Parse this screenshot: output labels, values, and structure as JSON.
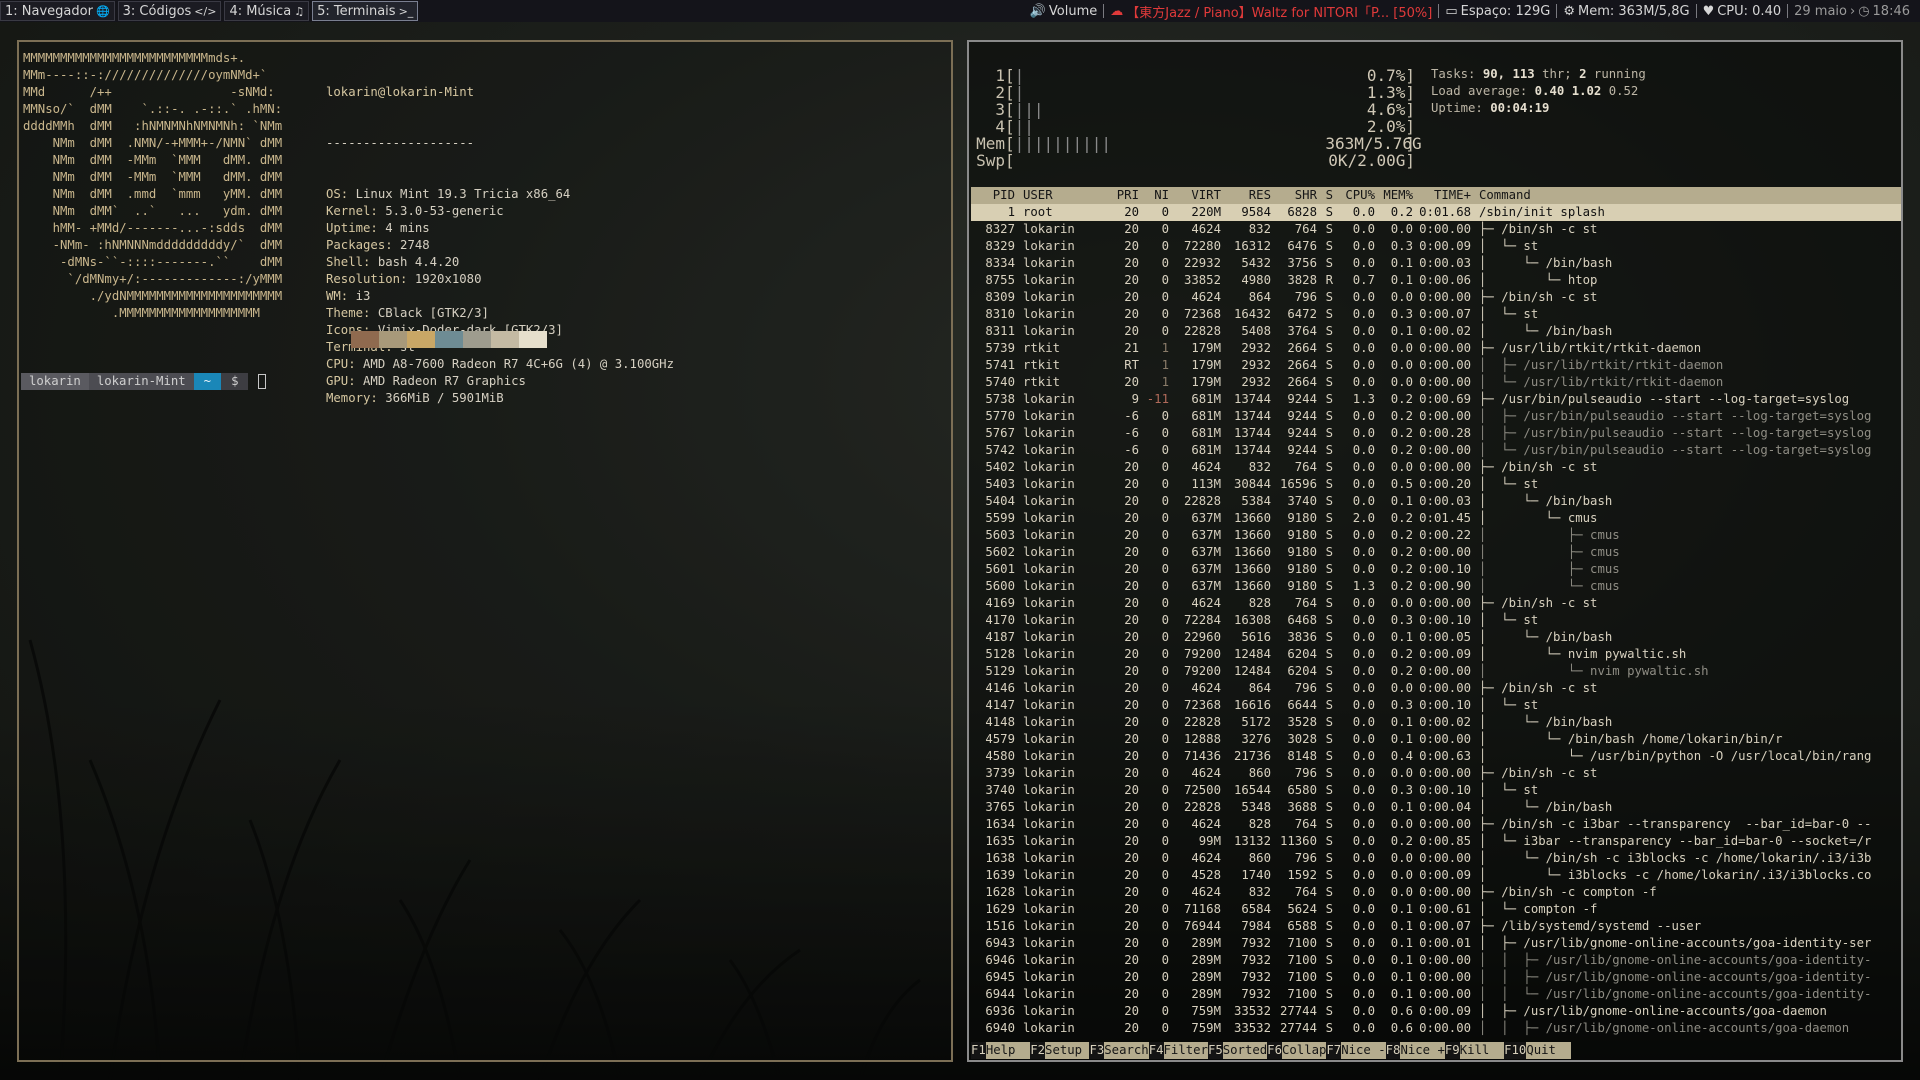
{
  "workspaces": [
    {
      "label": "1: Navegador",
      "icon": "globe-icon",
      "glyph": "🌐",
      "focused": false
    },
    {
      "label": "3: Códigos",
      "icon": "code-icon",
      "glyph": "</>",
      "focused": false
    },
    {
      "label": "4: Música",
      "icon": "music-icon",
      "glyph": "♫",
      "focused": false
    },
    {
      "label": "5: Terminais",
      "icon": "terminal-icon",
      "glyph": ">_",
      "focused": true
    }
  ],
  "statusbar": {
    "volume": "Volume",
    "music": "【東方Jazz / Piano】Waltz for NITORI「P... [50%]",
    "disk": "Espaço: 129G",
    "mem": "Mem: 363M/5,8G",
    "cpu": "CPU: 0.40",
    "date": "29 maio",
    "time": "18:46",
    "music_color": "#e03a3a"
  },
  "neofetch": {
    "ascii": [
      "MMMMMMMMMMMMMMMMMMMMMMMMMmds+.",
      "MMm----::-://////////////oymNMd+`",
      "MMd      /++                -sNMd:",
      "MMNso/`  dMM    `.::-. .-::.` .hMN:",
      "ddddMMh  dMM   :hNMNMNhNMNMNh: `NMm",
      "    NMm  dMM  .NMN/-+MMM+-/NMN` dMM",
      "    NMm  dMM  -MMm  `MMM   dMM. dMM",
      "    NMm  dMM  -MMm  `MMM   dMM. dMM",
      "    NMm  dMM  .mmd  `mmm   yMM. dMM",
      "    NMm  dMM`  ..`   ...   ydm. dMM",
      "    hMM- +MMd/-------...-:sdds  dMM",
      "    -NMm- :hNMNNNmdddddddddy/`  dMM",
      "     -dMNs-``-::::-------.``    dMM",
      "      `/dMNmy+/:-------------:/yMMM",
      "         ./ydNMMMMMMMMMMMMMMMMMMMMM",
      "            .MMMMMMMMMMMMMMMMMMM"
    ],
    "user_host": "lokarin@lokarin-Mint",
    "underline": "--------------------",
    "info": [
      {
        "key": "OS",
        "value": "Linux Mint 19.3 Tricia x86_64"
      },
      {
        "key": "Kernel",
        "value": "5.3.0-53-generic"
      },
      {
        "key": "Uptime",
        "value": "4 mins"
      },
      {
        "key": "Packages",
        "value": "2748"
      },
      {
        "key": "Shell",
        "value": "bash 4.4.20"
      },
      {
        "key": "Resolution",
        "value": "1920x1080"
      },
      {
        "key": "WM",
        "value": "i3"
      },
      {
        "key": "Theme",
        "value": "CBlack [GTK2/3]"
      },
      {
        "key": "Icons",
        "value": "Vimix-Doder-dark [GTK2/3]"
      },
      {
        "key": "Terminal",
        "value": "st"
      },
      {
        "key": "CPU",
        "value": "AMD A8-7600 Radeon R7 4C+6G (4) @ 3.100GHz"
      },
      {
        "key": "GPU",
        "value": "AMD Radeon R7 Graphics"
      },
      {
        "key": "Memory",
        "value": "366MiB / 5901MiB"
      }
    ],
    "palette": [
      "#8f6a4f",
      "#a8997a",
      "#c9a766",
      "#6e8c94",
      "#9e9c8e",
      "#c4baa3",
      "#e6dfcc"
    ]
  },
  "prompt": {
    "user": "lokarin",
    "host": "lokarin-Mint",
    "dir": "~",
    "symbol": "$"
  },
  "htop": {
    "cpus": [
      {
        "n": "1",
        "bars": "|",
        "val": "0.7%"
      },
      {
        "n": "2",
        "bars": "|",
        "val": "1.3%"
      },
      {
        "n": "3",
        "bars": "|||",
        "val": "4.6%"
      },
      {
        "n": "4",
        "bars": "||",
        "val": "2.0%"
      }
    ],
    "mem": {
      "label": "Mem",
      "bars": "||||||||||",
      "val": "363M/5.76G"
    },
    "swp": {
      "label": "Swp",
      "bars": "",
      "val": "0K/2.00G"
    },
    "tasks_label": "Tasks:",
    "tasks": "90,",
    "threads": "113",
    "thr_label": "thr;",
    "running": "2",
    "running_label": "running",
    "load_label": "Load average:",
    "load1": "0.40",
    "load5": "1.02",
    "load15": "0.52",
    "uptime_label": "Uptime:",
    "uptime": "00:04:19",
    "headers": [
      "PID",
      "USER",
      "PRI",
      "NI",
      "VIRT",
      "RES",
      "SHR",
      "S",
      "CPU%",
      "MEM%",
      "TIME+",
      "Command"
    ],
    "rows": [
      [
        "1",
        "root",
        "20",
        "0",
        "220M",
        "9584",
        "6828",
        "S",
        "0.0",
        "0.2",
        "0:01.68",
        "/sbin/init splash",
        0
      ],
      [
        "8327",
        "lokarin",
        "20",
        "0",
        "4624",
        "832",
        "764",
        "S",
        "0.0",
        "0.0",
        "0:00.00",
        "├─ /bin/sh -c st",
        0
      ],
      [
        "8329",
        "lokarin",
        "20",
        "0",
        "72280",
        "16312",
        "6476",
        "S",
        "0.0",
        "0.3",
        "0:00.09",
        "│  └─ st",
        0
      ],
      [
        "8334",
        "lokarin",
        "20",
        "0",
        "22932",
        "5432",
        "3756",
        "S",
        "0.0",
        "0.1",
        "0:00.03",
        "│     └─ /bin/bash",
        0
      ],
      [
        "8755",
        "lokarin",
        "20",
        "0",
        "33852",
        "4980",
        "3828",
        "R",
        "0.7",
        "0.1",
        "0:00.06",
        "│        └─ htop",
        0
      ],
      [
        "8309",
        "lokarin",
        "20",
        "0",
        "4624",
        "864",
        "796",
        "S",
        "0.0",
        "0.0",
        "0:00.00",
        "├─ /bin/sh -c st",
        0
      ],
      [
        "8310",
        "lokarin",
        "20",
        "0",
        "72368",
        "16432",
        "6472",
        "S",
        "0.0",
        "0.3",
        "0:00.07",
        "│  └─ st",
        0
      ],
      [
        "8311",
        "lokarin",
        "20",
        "0",
        "22828",
        "5408",
        "3764",
        "S",
        "0.0",
        "0.1",
        "0:00.02",
        "│     └─ /bin/bash",
        0
      ],
      [
        "5739",
        "rtkit",
        "21",
        "1",
        "179M",
        "2932",
        "2664",
        "S",
        "0.0",
        "0.0",
        "0:00.00",
        "├─ /usr/lib/rtkit/rtkit-daemon",
        0
      ],
      [
        "5741",
        "rtkit",
        "RT",
        "1",
        "179M",
        "2932",
        "2664",
        "S",
        "0.0",
        "0.0",
        "0:00.00",
        "│  ├─ /usr/lib/rtkit/rtkit-daemon",
        1
      ],
      [
        "5740",
        "rtkit",
        "20",
        "1",
        "179M",
        "2932",
        "2664",
        "S",
        "0.0",
        "0.0",
        "0:00.00",
        "│  └─ /usr/lib/rtkit/rtkit-daemon",
        1
      ],
      [
        "5738",
        "lokarin",
        "9",
        "-11",
        "681M",
        "13744",
        "9244",
        "S",
        "1.3",
        "0.2",
        "0:00.69",
        "├─ /usr/bin/pulseaudio --start --log-target=syslog",
        0
      ],
      [
        "5770",
        "lokarin",
        "-6",
        "0",
        "681M",
        "13744",
        "9244",
        "S",
        "0.0",
        "0.2",
        "0:00.00",
        "│  ├─ /usr/bin/pulseaudio --start --log-target=syslog",
        1
      ],
      [
        "5767",
        "lokarin",
        "-6",
        "0",
        "681M",
        "13744",
        "9244",
        "S",
        "0.0",
        "0.2",
        "0:00.28",
        "│  ├─ /usr/bin/pulseaudio --start --log-target=syslog",
        1
      ],
      [
        "5742",
        "lokarin",
        "-6",
        "0",
        "681M",
        "13744",
        "9244",
        "S",
        "0.0",
        "0.2",
        "0:00.00",
        "│  └─ /usr/bin/pulseaudio --start --log-target=syslog",
        1
      ],
      [
        "5402",
        "lokarin",
        "20",
        "0",
        "4624",
        "832",
        "764",
        "S",
        "0.0",
        "0.0",
        "0:00.00",
        "├─ /bin/sh -c st",
        0
      ],
      [
        "5403",
        "lokarin",
        "20",
        "0",
        "113M",
        "30844",
        "16596",
        "S",
        "0.0",
        "0.5",
        "0:00.20",
        "│  └─ st",
        0
      ],
      [
        "5404",
        "lokarin",
        "20",
        "0",
        "22828",
        "5384",
        "3740",
        "S",
        "0.0",
        "0.1",
        "0:00.03",
        "│     └─ /bin/bash",
        0
      ],
      [
        "5599",
        "lokarin",
        "20",
        "0",
        "637M",
        "13660",
        "9180",
        "S",
        "2.0",
        "0.2",
        "0:01.45",
        "│        └─ cmus",
        0
      ],
      [
        "5603",
        "lokarin",
        "20",
        "0",
        "637M",
        "13660",
        "9180",
        "S",
        "0.0",
        "0.2",
        "0:00.22",
        "│           ├─ cmus",
        1
      ],
      [
        "5602",
        "lokarin",
        "20",
        "0",
        "637M",
        "13660",
        "9180",
        "S",
        "0.0",
        "0.2",
        "0:00.00",
        "│           ├─ cmus",
        1
      ],
      [
        "5601",
        "lokarin",
        "20",
        "0",
        "637M",
        "13660",
        "9180",
        "S",
        "0.0",
        "0.2",
        "0:00.10",
        "│           ├─ cmus",
        1
      ],
      [
        "5600",
        "lokarin",
        "20",
        "0",
        "637M",
        "13660",
        "9180",
        "S",
        "1.3",
        "0.2",
        "0:00.90",
        "│           └─ cmus",
        1
      ],
      [
        "4169",
        "lokarin",
        "20",
        "0",
        "4624",
        "828",
        "764",
        "S",
        "0.0",
        "0.0",
        "0:00.00",
        "├─ /bin/sh -c st",
        0
      ],
      [
        "4170",
        "lokarin",
        "20",
        "0",
        "72284",
        "16308",
        "6468",
        "S",
        "0.0",
        "0.3",
        "0:00.10",
        "│  └─ st",
        0
      ],
      [
        "4187",
        "lokarin",
        "20",
        "0",
        "22960",
        "5616",
        "3836",
        "S",
        "0.0",
        "0.1",
        "0:00.05",
        "│     └─ /bin/bash",
        0
      ],
      [
        "5128",
        "lokarin",
        "20",
        "0",
        "79200",
        "12484",
        "6204",
        "S",
        "0.0",
        "0.2",
        "0:00.09",
        "│        └─ nvim pywaltic.sh",
        0
      ],
      [
        "5129",
        "lokarin",
        "20",
        "0",
        "79200",
        "12484",
        "6204",
        "S",
        "0.0",
        "0.2",
        "0:00.00",
        "│           └─ nvim pywaltic.sh",
        1
      ],
      [
        "4146",
        "lokarin",
        "20",
        "0",
        "4624",
        "864",
        "796",
        "S",
        "0.0",
        "0.0",
        "0:00.00",
        "├─ /bin/sh -c st",
        0
      ],
      [
        "4147",
        "lokarin",
        "20",
        "0",
        "72368",
        "16616",
        "6644",
        "S",
        "0.0",
        "0.3",
        "0:00.10",
        "│  └─ st",
        0
      ],
      [
        "4148",
        "lokarin",
        "20",
        "0",
        "22828",
        "5172",
        "3528",
        "S",
        "0.0",
        "0.1",
        "0:00.02",
        "│     └─ /bin/bash",
        0
      ],
      [
        "4579",
        "lokarin",
        "20",
        "0",
        "12888",
        "3276",
        "3028",
        "S",
        "0.0",
        "0.1",
        "0:00.00",
        "│        └─ /bin/bash /home/lokarin/bin/r",
        0
      ],
      [
        "4580",
        "lokarin",
        "20",
        "0",
        "71436",
        "21736",
        "8148",
        "S",
        "0.0",
        "0.4",
        "0:00.63",
        "│           └─ /usr/bin/python -O /usr/local/bin/rang",
        0
      ],
      [
        "3739",
        "lokarin",
        "20",
        "0",
        "4624",
        "860",
        "796",
        "S",
        "0.0",
        "0.0",
        "0:00.00",
        "├─ /bin/sh -c st",
        0
      ],
      [
        "3740",
        "lokarin",
        "20",
        "0",
        "72500",
        "16544",
        "6580",
        "S",
        "0.0",
        "0.3",
        "0:00.10",
        "│  └─ st",
        0
      ],
      [
        "3765",
        "lokarin",
        "20",
        "0",
        "22828",
        "5348",
        "3688",
        "S",
        "0.0",
        "0.1",
        "0:00.04",
        "│     └─ /bin/bash",
        0
      ],
      [
        "1634",
        "lokarin",
        "20",
        "0",
        "4624",
        "828",
        "764",
        "S",
        "0.0",
        "0.0",
        "0:00.00",
        "├─ /bin/sh -c i3bar --transparency  --bar_id=bar-0 --",
        0
      ],
      [
        "1635",
        "lokarin",
        "20",
        "0",
        "99M",
        "13132",
        "11360",
        "S",
        "0.0",
        "0.2",
        "0:00.85",
        "│  └─ i3bar --transparency --bar_id=bar-0 --socket=/r",
        0
      ],
      [
        "1638",
        "lokarin",
        "20",
        "0",
        "4624",
        "860",
        "796",
        "S",
        "0.0",
        "0.0",
        "0:00.00",
        "│     └─ /bin/sh -c i3blocks -c /home/lokarin/.i3/i3b",
        0
      ],
      [
        "1639",
        "lokarin",
        "20",
        "0",
        "4528",
        "1740",
        "1592",
        "S",
        "0.0",
        "0.0",
        "0:00.09",
        "│        └─ i3blocks -c /home/lokarin/.i3/i3blocks.co",
        0
      ],
      [
        "1628",
        "lokarin",
        "20",
        "0",
        "4624",
        "832",
        "764",
        "S",
        "0.0",
        "0.0",
        "0:00.00",
        "├─ /bin/sh -c compton -f",
        0
      ],
      [
        "1629",
        "lokarin",
        "20",
        "0",
        "71168",
        "6584",
        "5624",
        "S",
        "0.0",
        "0.1",
        "0:00.61",
        "│  └─ compton -f",
        0
      ],
      [
        "1516",
        "lokarin",
        "20",
        "0",
        "76944",
        "7984",
        "6588",
        "S",
        "0.0",
        "0.1",
        "0:00.07",
        "├─ /lib/systemd/systemd --user",
        0
      ],
      [
        "6943",
        "lokarin",
        "20",
        "0",
        "289M",
        "7932",
        "7100",
        "S",
        "0.0",
        "0.1",
        "0:00.01",
        "│  ├─ /usr/lib/gnome-online-accounts/goa-identity-ser",
        0
      ],
      [
        "6946",
        "lokarin",
        "20",
        "0",
        "289M",
        "7932",
        "7100",
        "S",
        "0.0",
        "0.1",
        "0:00.00",
        "│  │  ├─ /usr/lib/gnome-online-accounts/goa-identity-",
        1
      ],
      [
        "6945",
        "lokarin",
        "20",
        "0",
        "289M",
        "7932",
        "7100",
        "S",
        "0.0",
        "0.1",
        "0:00.00",
        "│  │  ├─ /usr/lib/gnome-online-accounts/goa-identity-",
        1
      ],
      [
        "6944",
        "lokarin",
        "20",
        "0",
        "289M",
        "7932",
        "7100",
        "S",
        "0.0",
        "0.1",
        "0:00.00",
        "│  │  └─ /usr/lib/gnome-online-accounts/goa-identity-",
        1
      ],
      [
        "6936",
        "lokarin",
        "20",
        "0",
        "759M",
        "33532",
        "27744",
        "S",
        "0.0",
        "0.6",
        "0:00.09",
        "│  ├─ /usr/lib/gnome-online-accounts/goa-daemon",
        0
      ],
      [
        "6940",
        "lokarin",
        "20",
        "0",
        "759M",
        "33532",
        "27744",
        "S",
        "0.0",
        "0.6",
        "0:00.00",
        "│  │  ├─ /usr/lib/gnome-online-accounts/goa-daemon",
        1
      ]
    ],
    "fkeys": [
      {
        "n": "F1",
        "t": "Help  "
      },
      {
        "n": "F2",
        "t": "Setup "
      },
      {
        "n": "F3",
        "t": "Search"
      },
      {
        "n": "F4",
        "t": "Filter"
      },
      {
        "n": "F5",
        "t": "Sorted"
      },
      {
        "n": "F6",
        "t": "Collap"
      },
      {
        "n": "F7",
        "t": "Nice -"
      },
      {
        "n": "F8",
        "t": "Nice +"
      },
      {
        "n": "F9",
        "t": "Kill  "
      },
      {
        "n": "F10",
        "t": "Quit  "
      }
    ]
  }
}
